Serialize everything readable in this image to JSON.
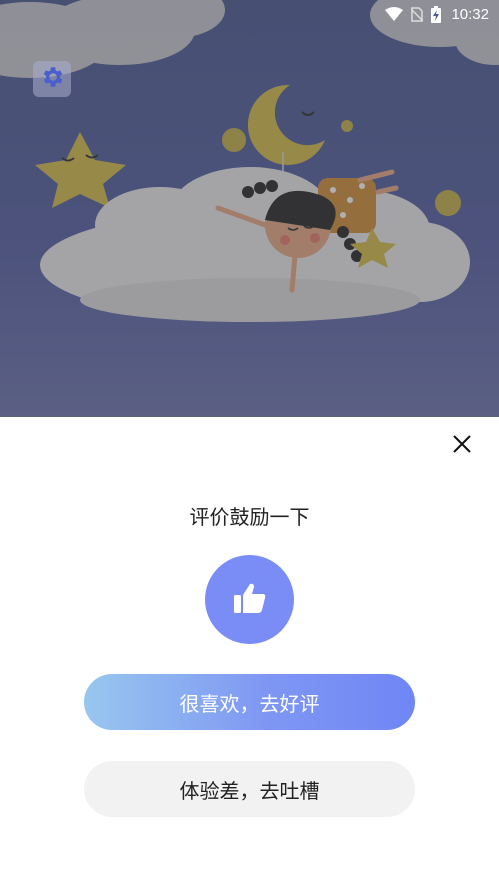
{
  "status_bar": {
    "time": "10:32",
    "icons": [
      "wifi-icon",
      "no-sim-icon",
      "battery-charging-icon"
    ]
  },
  "hero": {
    "settings_icon": "gear-icon"
  },
  "dialog": {
    "title": "评价鼓励一下",
    "close_icon": "close-icon",
    "thumb_icon": "thumbs-up-icon",
    "good_button": "很喜欢，去好评",
    "bad_button": "体验差，去吐槽"
  },
  "colors": {
    "accent": "#7a8cf6",
    "gradient_start": "#98c7ef",
    "gradient_end": "#6f86f5",
    "hero_bg": "#4d5a8c",
    "secondary_button": "#f2f2f2"
  }
}
